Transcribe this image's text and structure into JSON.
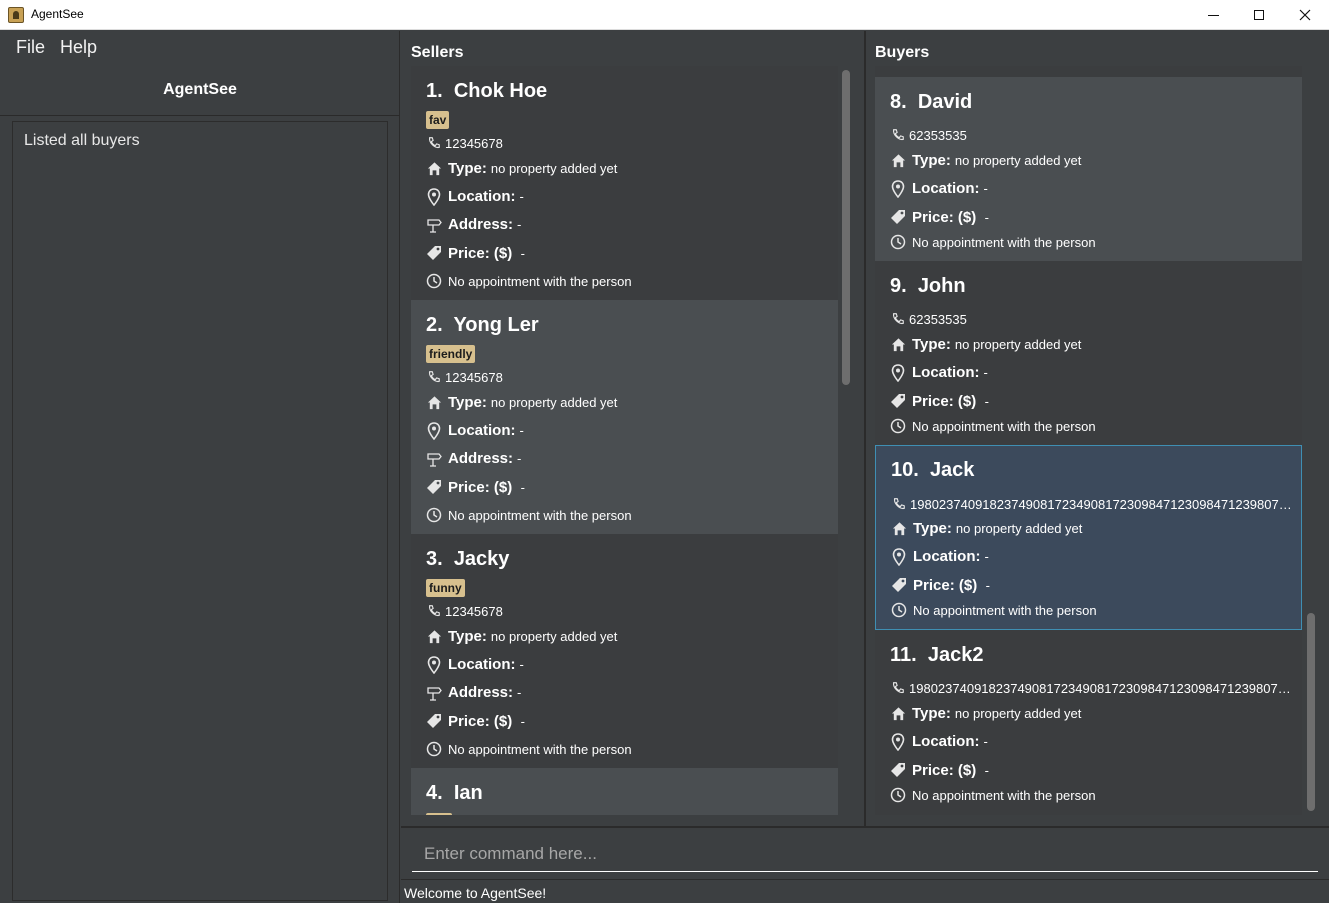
{
  "window": {
    "title": "AgentSee"
  },
  "menu": {
    "file": "File",
    "help": "Help"
  },
  "sidebar": {
    "heading": "AgentSee",
    "result": "Listed all buyers"
  },
  "sellers": {
    "title": "Sellers",
    "items": [
      {
        "index": "1.",
        "name": "Chok Hoe",
        "tag": "fav",
        "phone": "12345678",
        "type_label": "Type:",
        "type": "no property added yet",
        "location_label": "Location:",
        "location": "-",
        "address_label": "Address:",
        "address": "-",
        "price_label": "Price: ($)",
        "price": "-",
        "appointment": "No appointment with the person"
      },
      {
        "index": "2.",
        "name": "Yong Ler",
        "tag": "friendly",
        "phone": "12345678",
        "type_label": "Type:",
        "type": "no property added yet",
        "location_label": "Location:",
        "location": "-",
        "address_label": "Address:",
        "address": "-",
        "price_label": "Price: ($)",
        "price": "-",
        "appointment": "No appointment with the person"
      },
      {
        "index": "3.",
        "name": "Jacky",
        "tag": "funny",
        "phone": "12345678",
        "type_label": "Type:",
        "type": "no property added yet",
        "location_label": "Location:",
        "location": "-",
        "address_label": "Address:",
        "address": "-",
        "price_label": "Price: ($)",
        "price": "-",
        "appointment": "No appointment with the person"
      },
      {
        "index": "4.",
        "name": "Ian"
      }
    ]
  },
  "buyers": {
    "title": "Buyers",
    "items": [
      {
        "index": "8.",
        "name": "David",
        "phone": "62353535",
        "type_label": "Type:",
        "type": "no property added yet",
        "location_label": "Location:",
        "location": "-",
        "price_label": "Price: ($)",
        "price": "-",
        "appointment": "No appointment with the person"
      },
      {
        "index": "9.",
        "name": "John",
        "phone": "62353535",
        "type_label": "Type:",
        "type": "no property added yet",
        "location_label": "Location:",
        "location": "-",
        "price_label": "Price: ($)",
        "price": "-",
        "appointment": "No appointment with the person"
      },
      {
        "index": "10.",
        "name": "Jack",
        "phone": "198023740918237490817234908172309847123098471239807489...",
        "type_label": "Type:",
        "type": "no property added yet",
        "location_label": "Location:",
        "location": "-",
        "price_label": "Price: ($)",
        "price": "-",
        "appointment": "No appointment with the person"
      },
      {
        "index": "11.",
        "name": "Jack2",
        "phone": "198023740918237490817234908172309847123098471239807489...",
        "type_label": "Type:",
        "type": "no property added yet",
        "location_label": "Location:",
        "location": "-",
        "price_label": "Price: ($)",
        "price": "-",
        "appointment": "No appointment with the person"
      }
    ]
  },
  "command": {
    "placeholder": "Enter command here..."
  },
  "status": {
    "text": "Welcome to AgentSee!"
  },
  "colors": {
    "background": "#3c3f41",
    "card_alt": "#4a4e51",
    "card_base": "#3b3d3f",
    "selected": "#3c4a5c",
    "selected_border": "#3f8fb3",
    "tag": "#d7c08e"
  }
}
